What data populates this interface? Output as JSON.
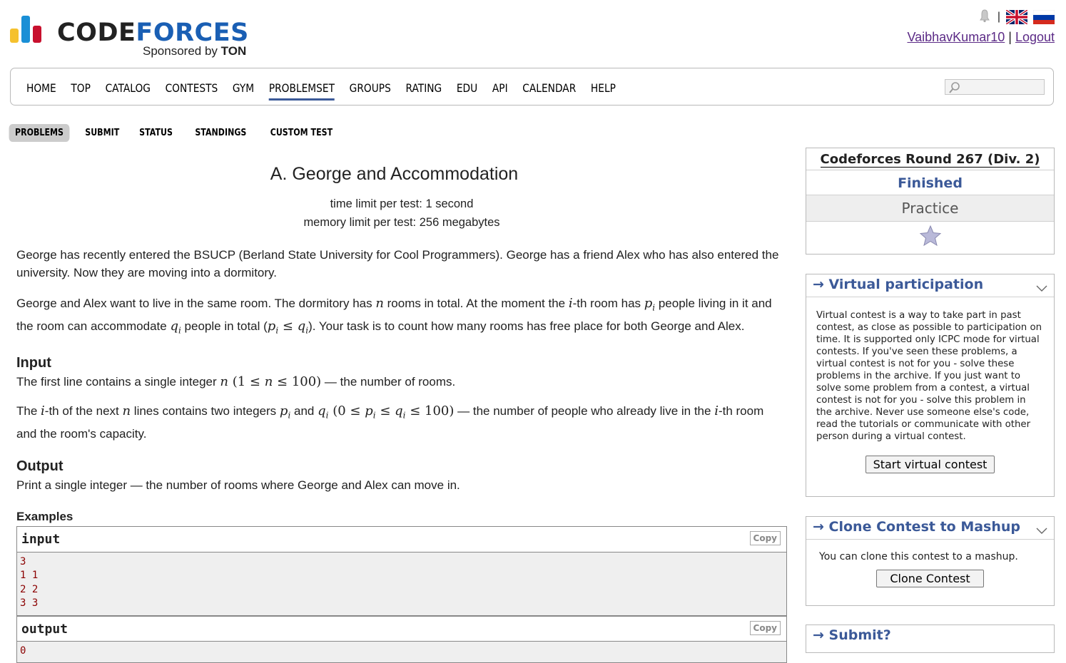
{
  "header": {
    "logo_word1": "CODE",
    "logo_word2": "FORCES",
    "sponsor_prefix": "Sponsored by",
    "sponsor_name": "TON",
    "separator": "|",
    "username": "VaibhavKumar10",
    "logout": "Logout",
    "logo_colors": [
      "#f5c12e",
      "#1a8fd6",
      "#c8102e"
    ]
  },
  "nav": {
    "items": [
      "HOME",
      "TOP",
      "CATALOG",
      "CONTESTS",
      "GYM",
      "PROBLEMSET",
      "GROUPS",
      "RATING",
      "EDU",
      "API",
      "CALENDAR",
      "HELP"
    ],
    "active": "PROBLEMSET"
  },
  "subtabs": {
    "items": [
      "PROBLEMS",
      "SUBMIT",
      "STATUS",
      "STANDINGS",
      "CUSTOM TEST"
    ],
    "active": "PROBLEMS"
  },
  "problem": {
    "title": "A. George and Accommodation",
    "time_limit": "time limit per test: 1 second",
    "memory_limit": "memory limit per test: 256 megabytes",
    "statement_1": "George has recently entered the BSUCP (Berland State University for Cool Programmers). George has a friend Alex who has also entered the university. Now they are moving into a dormitory.",
    "statement_2a": "George and Alex want to live in the same room. The dormitory has ",
    "statement_2b": " rooms in total. At the moment the ",
    "statement_2c": "-th room has ",
    "statement_2d": " people living in it and the room can accommodate ",
    "statement_2e": " people in total (",
    "statement_2f": "). Your task is to count how many rooms has free place for both George and Alex.",
    "input_title": "Input",
    "input_1a": "The first line contains a single integer ",
    "input_1b": " — the number of rooms.",
    "input_2a": "The ",
    "input_2b": "-th of the next ",
    "input_2c": " lines contains two integers ",
    "input_2d": " and ",
    "input_2e": " — the number of people who already live in the ",
    "input_2f": "-th room and the room's capacity.",
    "output_title": "Output",
    "output_text": "Print a single integer — the number of rooms where George and Alex can move in.",
    "examples_title": "Examples",
    "sample_input_label": "input",
    "sample_output_label": "output",
    "copy_label": "Copy",
    "sample_input_lines": [
      "3",
      "1 1",
      "2 2",
      "3 3"
    ],
    "sample_output_lines": [
      "0"
    ]
  },
  "sidebar": {
    "round_title": "Codeforces Round 267 (Div. 2)",
    "round_status": "Finished",
    "round_mode": "Practice",
    "vp_title": "→ Virtual participation",
    "vp_text": "Virtual contest is a way to take part in past contest, as close as possible to participation on time. It is supported only ICPC mode for virtual contests. If you've seen these problems, a virtual contest is not for you - solve these problems in the archive. If you just want to solve some problem from a contest, a virtual contest is not for you - solve this problem in the archive. Never use someone else's code, read the tutorials or communicate with other person during a virtual contest.",
    "vp_button": "Start virtual contest",
    "clone_title": "→ Clone Contest to Mashup",
    "clone_text": "You can clone this contest to a mashup.",
    "clone_button": "Clone Contest",
    "submit_title": "→ Submit?"
  }
}
